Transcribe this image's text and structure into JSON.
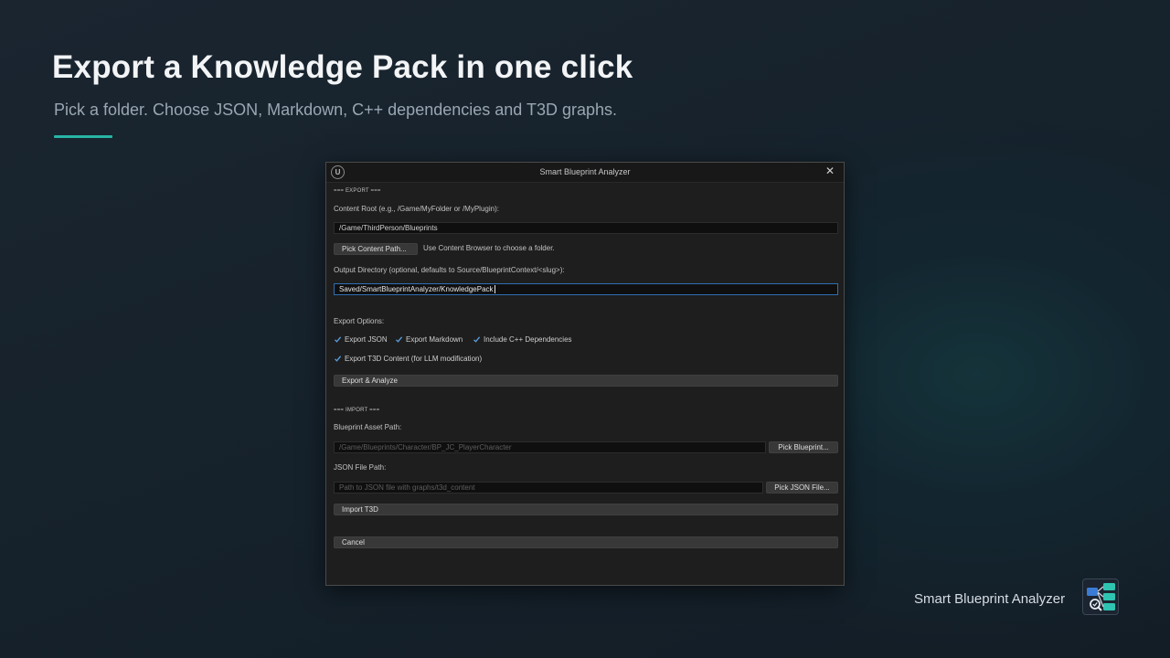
{
  "hero": {
    "title": "Export a Knowledge Pack in one click",
    "subtitle": "Pick a folder. Choose JSON, Markdown, C++ dependencies and T3D graphs."
  },
  "window": {
    "title": "Smart Blueprint Analyzer",
    "close_glyph": "✕",
    "logo_glyph": "U"
  },
  "export": {
    "section_label": "=== EXPORT ===",
    "content_root_label": "Content Root (e.g., /Game/MyFolder or /MyPlugin):",
    "content_root_value": "/Game/ThirdPerson/Blueprints",
    "pick_content_path_button": "Pick Content Path...",
    "pick_content_hint": "Use Content Browser to choose a folder.",
    "output_dir_label": "Output Directory (optional, defaults to Source/BlueprintContext/<slug>):",
    "output_dir_value": "Saved/SmartBlueprintAnalyzer/KnowledgePack",
    "options_label": "Export Options:",
    "options": [
      {
        "label": "Export JSON",
        "checked": true
      },
      {
        "label": "Export Markdown",
        "checked": true
      },
      {
        "label": "Include C++ Dependencies",
        "checked": true
      },
      {
        "label": "Export T3D Content (for LLM modification)",
        "checked": true
      }
    ],
    "export_button": "Export & Analyze"
  },
  "import": {
    "section_label": "=== IMPORT ===",
    "asset_path_label": "Blueprint Asset Path:",
    "asset_path_placeholder": "/Game/Blueprints/Character/BP_JC_PlayerCharacter",
    "pick_blueprint_button": "Pick Blueprint...",
    "json_path_label": "JSON File Path:",
    "json_path_placeholder": "Path to JSON file with graphs/t3d_content",
    "pick_json_button": "Pick JSON File...",
    "import_button": "Import T3D"
  },
  "cancel_button": "Cancel",
  "brand": {
    "label": "Smart Blueprint Analyzer",
    "icon": "blueprint-analyzer-icon"
  },
  "colors": {
    "accent": "#27b5a6",
    "checkmark": "#5aa0e0",
    "focus_border": "#2f6fb2"
  }
}
